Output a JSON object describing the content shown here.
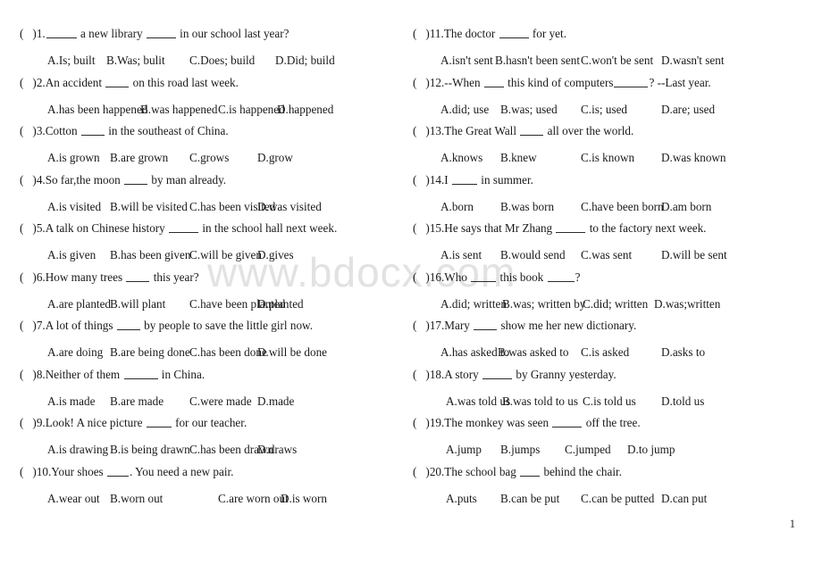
{
  "watermark": {
    "text": "www.bdocx.com"
  },
  "page": {
    "number": "1"
  },
  "marker": {
    "open": "(",
    "close": ")"
  },
  "columns": [
    {
      "id": "left",
      "questions": [
        {
          "number": "1.",
          "stem_parts": [
            "",
            " a new library ",
            " in our school last year?"
          ],
          "blanks": [
            34,
            33
          ],
          "stem_plain": "1.______ a new library ______ in our school last year?",
          "options": [
            "A.Is; built",
            "B.Was; bulit",
            "C.Does; build",
            "D.Did; build"
          ],
          "option_layout": "run-ab"
        },
        {
          "number": "2.",
          "stem_parts": [
            "An accident ",
            " on this road last week."
          ],
          "blanks": [
            26
          ],
          "stem_plain": "2.An accident ____ on this road last week.",
          "options": [
            "A.has been happened",
            "B.was happened",
            "C.is happened",
            "D.happened"
          ],
          "option_layout": "wide-run-cd"
        },
        {
          "number": "3.",
          "stem_parts": [
            "Cotton ",
            " in the southeast of China."
          ],
          "blanks": [
            26
          ],
          "stem_plain": "3.Cotton ____ in the southeast of China.",
          "options": [
            "A.is grown",
            "B.are grown",
            "C.grows",
            "D.grow"
          ],
          "option_layout": "normal"
        },
        {
          "number": "4.",
          "stem_parts": [
            "So far,the moon ",
            " by man already."
          ],
          "blanks": [
            26
          ],
          "stem_plain": "4.So far,the moon ____ by man already.",
          "options": [
            "A.is visited",
            "B.will be visited",
            "C.has been visited",
            "D.was visited"
          ],
          "option_layout": "normal"
        },
        {
          "number": "5.",
          "stem_parts": [
            "A talk on Chinese history ",
            " in the school hall next week."
          ],
          "blanks": [
            33
          ],
          "stem_plain": "5.A talk on Chinese history ______ in the school hall next week.",
          "options": [
            "A.is given",
            "B.has been given",
            "C.will be given",
            "D.gives"
          ],
          "option_layout": "normal"
        },
        {
          "number": "6.",
          "stem_parts": [
            "How many trees ",
            " this year?"
          ],
          "blanks": [
            26
          ],
          "stem_plain": "6.How many trees ____ this year?",
          "options": [
            "A.are planted",
            "B.will plant",
            "C.have been planted",
            "D.planted"
          ],
          "option_layout": "normal"
        },
        {
          "number": "7.",
          "stem_parts": [
            "A lot of things ",
            " by people to save the little girl now."
          ],
          "blanks": [
            26
          ],
          "stem_plain": "7.A lot of things ____ by people to save the little girl now.",
          "options": [
            "A.are doing",
            "B.are being done",
            "C.has been done",
            "D.will be done"
          ],
          "option_layout": "normal"
        },
        {
          "number": "8.",
          "stem_parts": [
            "Neither of them ",
            " in China."
          ],
          "blanks": [
            38
          ],
          "stem_plain": "8.Neither of them _______ in China.",
          "options": [
            "A.is made",
            "B.are made",
            "C.were made",
            "D.made"
          ],
          "option_layout": "normal"
        },
        {
          "number": "9.",
          "stem_parts": [
            "Look! A nice picture ",
            " for our teacher."
          ],
          "blanks": [
            28
          ],
          "stem_plain": "9.Look! A nice picture ____ for our teacher.",
          "options": [
            "A.is drawing",
            "B.is being drawn",
            "C.has been drawn",
            "D.draws"
          ],
          "option_layout": "normal"
        },
        {
          "number": "10.",
          "stem_parts": [
            "Your shoes ",
            ". You need a new pair."
          ],
          "blanks": [
            24
          ],
          "stem_plain": "10.Your shoes ____. You need a new pair.",
          "options": [
            "A.wear out",
            "B.worn out",
            "C.are worn out",
            "D.is worn"
          ],
          "option_layout": "run-cd"
        }
      ]
    },
    {
      "id": "right",
      "questions": [
        {
          "number": "11.",
          "stem_parts": [
            "The doctor ",
            " for yet."
          ],
          "blanks": [
            33
          ],
          "stem_plain": "11.The doctor ______ for yet.",
          "options": [
            "A.isn't sent",
            "B.hasn't been sent",
            "C.won't be sent",
            "D.wasn't sent"
          ],
          "option_layout": "run-ab"
        },
        {
          "number": "12.",
          "stem_parts": [
            "--When ",
            " this kind of computers",
            "? --Last year."
          ],
          "blanks": [
            22,
            38
          ],
          "stem_plain": "12.--When ___ this kind of computers______? --Last year.",
          "options": [
            "A.did; use",
            "B.was; used",
            "C.is; used",
            "D.are; used"
          ],
          "option_layout": "normal"
        },
        {
          "number": "13.",
          "stem_parts": [
            "The Great Wall ",
            " all over the world."
          ],
          "blanks": [
            26
          ],
          "stem_plain": "13.The Great Wall ____ all over the world.",
          "options": [
            "A.knows",
            "B.knew",
            "C.is known",
            "D.was known"
          ],
          "option_layout": "normal"
        },
        {
          "number": "14.",
          "stem_parts": [
            "I ",
            " in summer."
          ],
          "blanks": [
            28
          ],
          "stem_plain": "14.I ____ in summer.",
          "options": [
            "A.born",
            "B.was born",
            "C.have been born",
            "D.am born"
          ],
          "option_layout": "run-cd"
        },
        {
          "number": "15.",
          "stem_parts": [
            "He says that Mr Zhang ",
            " to the factory next week."
          ],
          "blanks": [
            33
          ],
          "stem_plain": "15.He says that Mr Zhang ______ to the factory next week.",
          "options": [
            "A.is sent",
            "B.would send",
            "C.was sent",
            "D.will be sent"
          ],
          "option_layout": "normal"
        },
        {
          "number": "16.",
          "stem_parts": [
            "Who ",
            " this book ",
            "?"
          ],
          "blanks": [
            28,
            30
          ],
          "stem_plain": "16.Who ____ this book _____?",
          "options": [
            "A.did; written",
            "B.was; written by",
            "C.did; written",
            "D.was;written"
          ],
          "option_layout": "tight"
        },
        {
          "number": "17.",
          "stem_parts": [
            "Mary ",
            " show me her new dictionary."
          ],
          "blanks": [
            26
          ],
          "stem_plain": "17.Mary ____ show me her new dictionary.",
          "options": [
            "A.has asked to",
            "B.was asked to",
            "C.is asked",
            "D.asks to"
          ],
          "option_layout": "tight-ab"
        },
        {
          "number": "18.",
          "stem_parts": [
            "A story ",
            " by Granny yesterday."
          ],
          "blanks": [
            33
          ],
          "stem_plain": "18.A story ______ by Granny yesterday.",
          "options": [
            "A.was told us",
            "B.was told to us",
            "C.is told us",
            "D.told us"
          ],
          "option_layout": "indent-tight-ab"
        },
        {
          "number": "19.",
          "stem_parts": [
            "The monkey was seen ",
            " off the tree."
          ],
          "blanks": [
            33
          ],
          "stem_plain": "19.The monkey was seen ______ off the tree.",
          "options": [
            "A.jump",
            "B.jumps",
            "C.jumped",
            "D.to jump"
          ],
          "option_layout": "narrow"
        },
        {
          "number": "20.",
          "stem_parts": [
            "The school bag ",
            " behind the chair."
          ],
          "blanks": [
            22
          ],
          "stem_plain": "20.The school bag ___ behind the chair.",
          "options": [
            "A.puts",
            "B.can be put",
            "C.can be putted",
            "D.can put"
          ],
          "option_layout": "indent"
        }
      ]
    }
  ]
}
